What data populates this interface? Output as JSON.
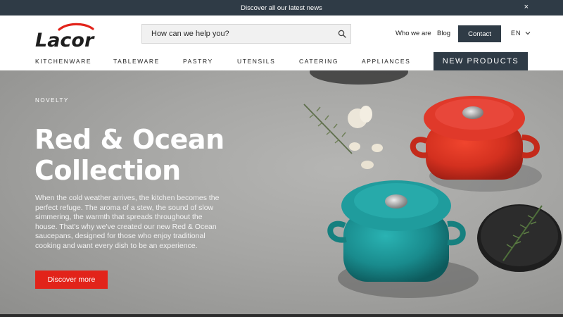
{
  "announcement": {
    "text": "Discover all our latest news",
    "close_glyph": "×"
  },
  "brand": {
    "name": "Lacor",
    "color": "#e2231a"
  },
  "search": {
    "placeholder": "How can we help you?",
    "icon": "search-icon"
  },
  "top_links": {
    "who": "Who we are",
    "blog": "Blog",
    "contact": "Contact",
    "lang": "EN"
  },
  "nav": {
    "items": [
      "KITCHENWARE",
      "TABLEWARE",
      "PASTRY",
      "UTENSILS",
      "CATERING",
      "APPLIANCES"
    ],
    "highlight": "NEW PRODUCTS"
  },
  "hero": {
    "eyebrow": "NOVELTY",
    "title_line1": "Red & Ocean",
    "title_line2": "Collection",
    "description": "When the cold weather arrives, the kitchen becomes the perfect refuge. The aroma of a stew, the sound of slow simmering, the warmth that spreads throughout the house. That's why we've created our new Red & Ocean saucepans, designed for those who enjoy traditional cooking and want every dish to be an experience.",
    "cta": "Discover more"
  },
  "colors": {
    "dark": "#2f3b46",
    "accent": "#e2231a",
    "red_pot": "#d8301f",
    "ocean_pot": "#1b8c8e"
  }
}
